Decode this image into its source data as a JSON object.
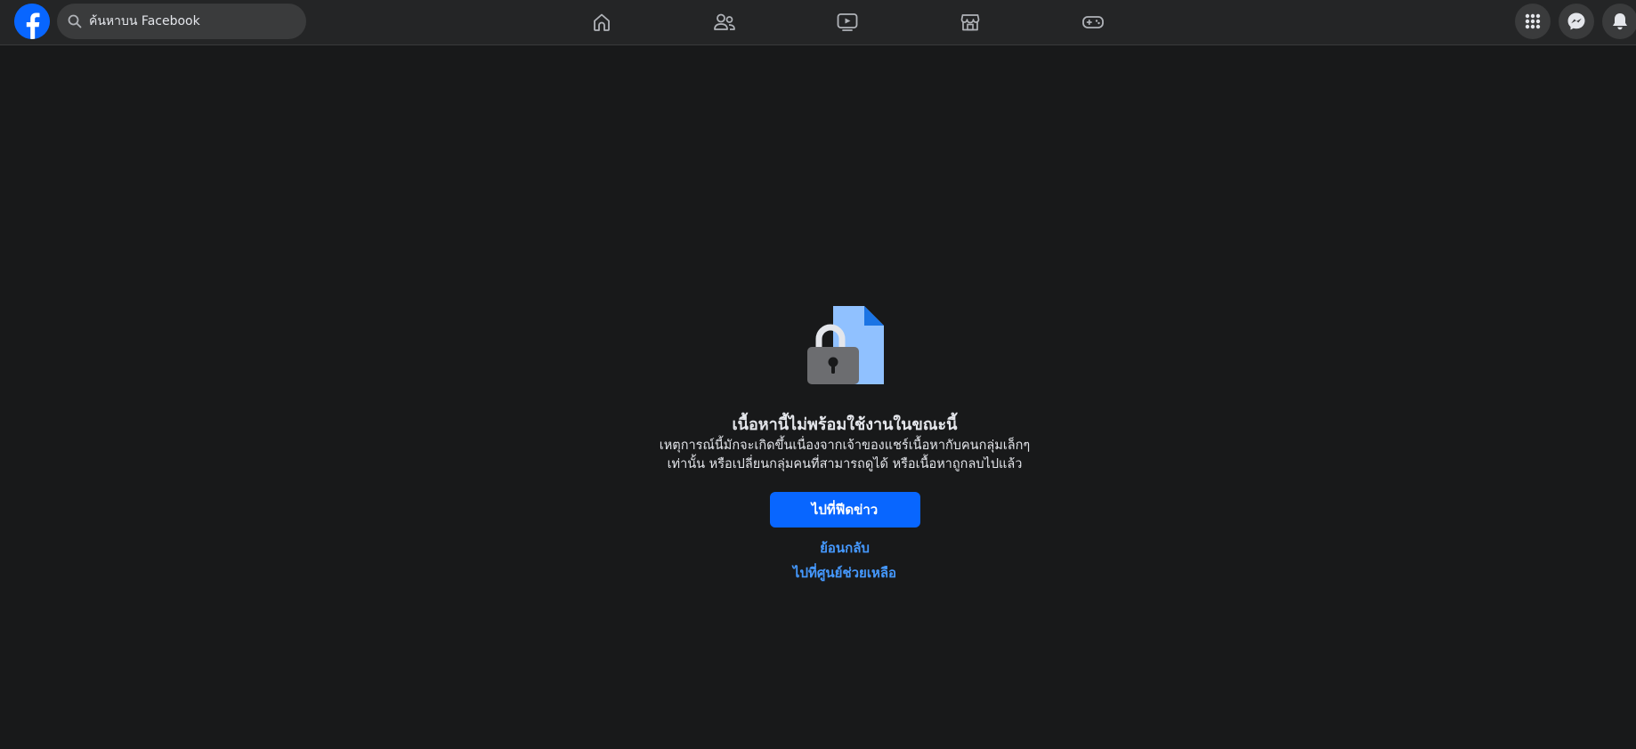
{
  "header": {
    "logo_icon": "facebook-logo",
    "search": {
      "placeholder": "ค้นหาบน Facebook",
      "icon": "search-icon"
    },
    "nav_tabs": [
      {
        "name": "home",
        "icon": "home-icon"
      },
      {
        "name": "friends",
        "icon": "friends-icon"
      },
      {
        "name": "video",
        "icon": "video-icon"
      },
      {
        "name": "marketplace",
        "icon": "marketplace-icon"
      },
      {
        "name": "gaming",
        "icon": "gaming-icon"
      }
    ],
    "right_buttons": [
      {
        "name": "menu",
        "icon": "grid-menu-icon"
      },
      {
        "name": "messenger",
        "icon": "messenger-icon"
      },
      {
        "name": "notifications",
        "icon": "bell-icon"
      }
    ]
  },
  "content": {
    "illustration_icon": "locked-document-icon",
    "heading": "เนื้อหานี้ไม่พร้อมใช้งานในขณะนี้",
    "description": "เหตุการณ์นี้มักจะเกิดขึ้นเนื่องจากเจ้าของแชร์เนื้อหากับคนกลุ่มเล็กๆ เท่านั้น หรือเปลี่ยนกลุ่มคนที่สามารถดูได้ หรือเนื้อหาถูกลบไปแล้ว",
    "primary_button": "ไปที่ฟีดข่าว",
    "back_link": "ย้อนกลับ",
    "help_link": "ไปที่ศูนย์ช่วยเหลือ"
  },
  "colors": {
    "background": "#18191a",
    "topbar": "#242526",
    "accent": "#0866ff",
    "link": "#4599ff",
    "text": "#e4e6eb",
    "icon": "#b0b3b8"
  }
}
